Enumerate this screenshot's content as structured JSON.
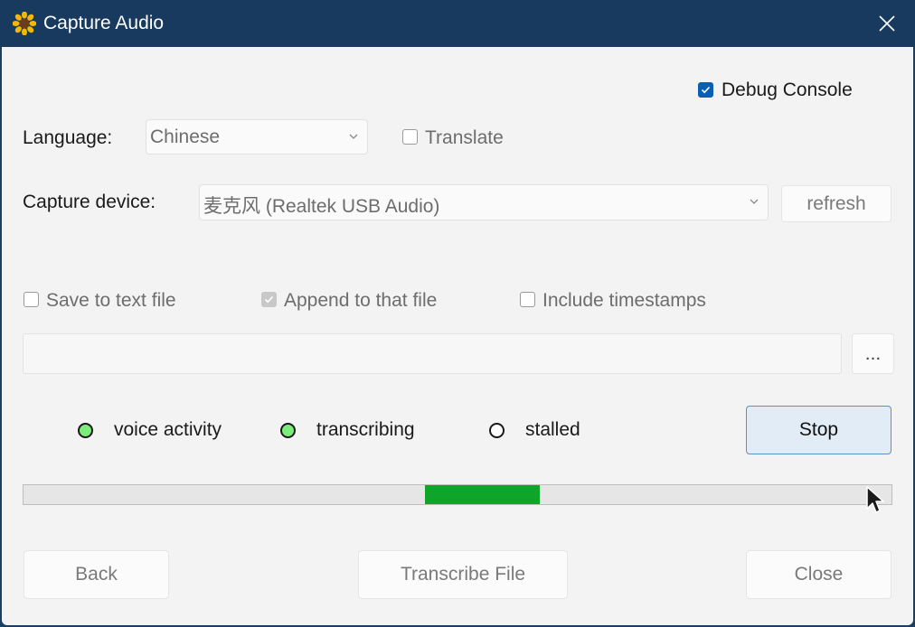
{
  "window": {
    "title": "Capture Audio"
  },
  "debug_console": {
    "label": "Debug Console",
    "checked": true
  },
  "language": {
    "label": "Language:",
    "value": "Chinese"
  },
  "translate": {
    "label": "Translate",
    "checked": false
  },
  "capture_device": {
    "label": "Capture device:",
    "value": "麦克风 (Realtek USB Audio)"
  },
  "refresh_button": "refresh",
  "save_to_file": {
    "label": "Save to text file",
    "checked": false
  },
  "append_to_file": {
    "label": "Append to that file",
    "checked": true
  },
  "include_timestamps": {
    "label": "Include timestamps",
    "checked": false
  },
  "file_path": {
    "value": ""
  },
  "browse_button": "...",
  "status": {
    "voice_activity": {
      "label": "voice activity",
      "active": true
    },
    "transcribing": {
      "label": "transcribing",
      "active": true
    },
    "stalled": {
      "label": "stalled",
      "active": false
    }
  },
  "stop_button": "Stop",
  "level_meter": {
    "segment_start": 0.462,
    "segment_end": 0.594,
    "color": "#0ea52a"
  },
  "footer": {
    "back": "Back",
    "transcribe_file": "Transcribe File",
    "close": "Close"
  },
  "colors": {
    "titlebar": "#173a5e",
    "accent": "#0a5fb4",
    "led_on": "#7cec7c"
  }
}
